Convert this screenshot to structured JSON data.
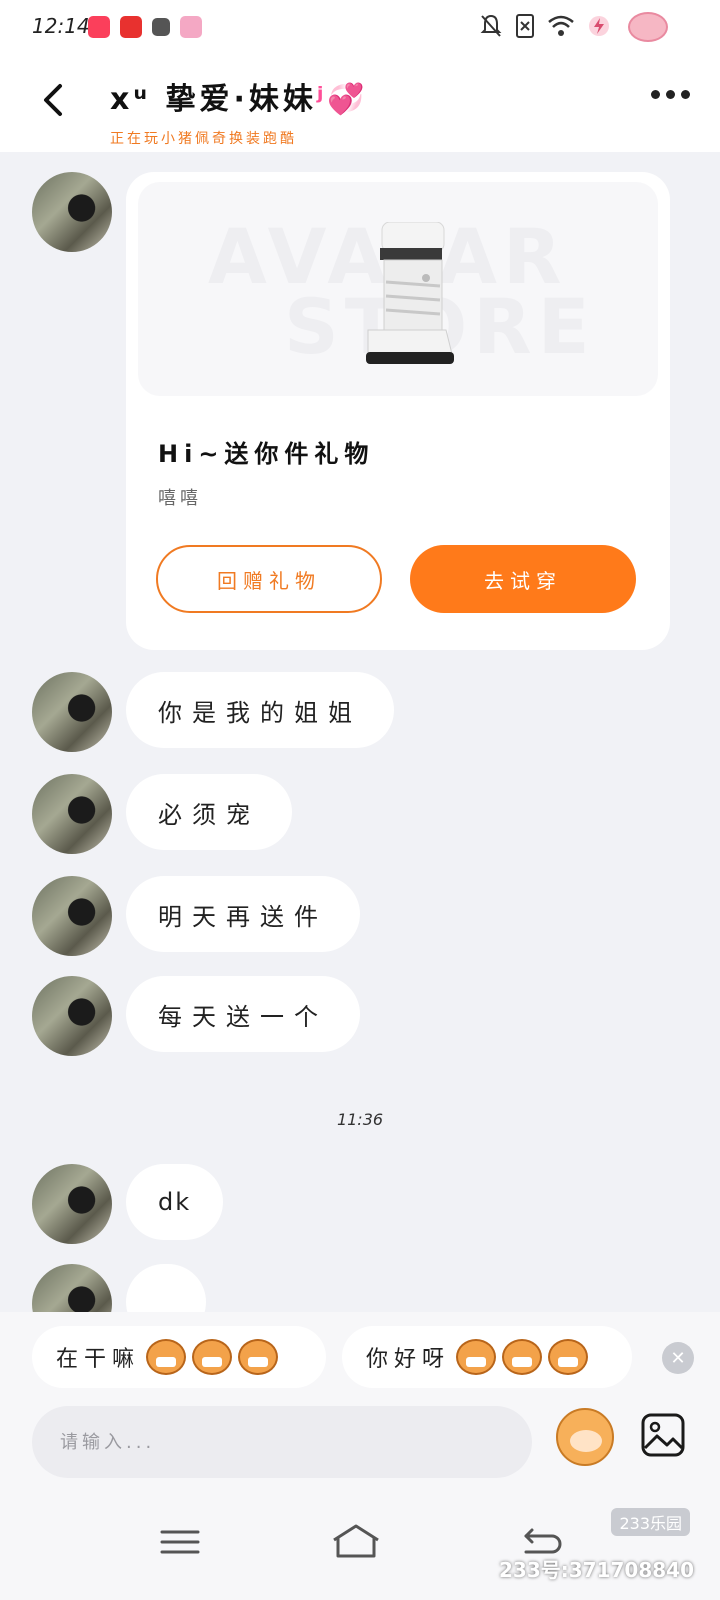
{
  "status_bar": {
    "time": "12:14",
    "icons": [
      "bilibili-app-icon",
      "red-app-icon",
      "storage-icon",
      "game-app-icon"
    ],
    "right_icons": [
      "mute-bell-icon",
      "sim-x-icon",
      "wifi-icon",
      "charging-icon",
      "pig-avatar-icon"
    ]
  },
  "header": {
    "title": "xᵘ 挚爱·妹妹",
    "title_suffix": "ʲ💞",
    "subtitle": "正在玩小猪佩奇换装跑酷"
  },
  "gift_card": {
    "watermark_top": "AVATAR",
    "watermark_bottom": "STORE",
    "greeting": "Hi~送你件礼物",
    "sub": "嘻嘻",
    "reply_button": "回赠礼物",
    "try_button": "去试穿"
  },
  "messages": [
    {
      "text": "你是我的姐姐"
    },
    {
      "text": "必须宠"
    },
    {
      "text": "明天再送件"
    },
    {
      "text": "每天送一个"
    }
  ],
  "time_separator": "11:36",
  "last_message": "dk",
  "quick_replies": [
    {
      "text": "在干嘛"
    },
    {
      "text": "你好呀"
    }
  ],
  "input": {
    "placeholder": "请输入..."
  },
  "watermark": {
    "badge": "233乐园",
    "id": "233号:371708840"
  },
  "colors": {
    "accent": "#ff7a1a",
    "chat_bg": "#f1f2f6",
    "bubble": "#ffffff"
  }
}
